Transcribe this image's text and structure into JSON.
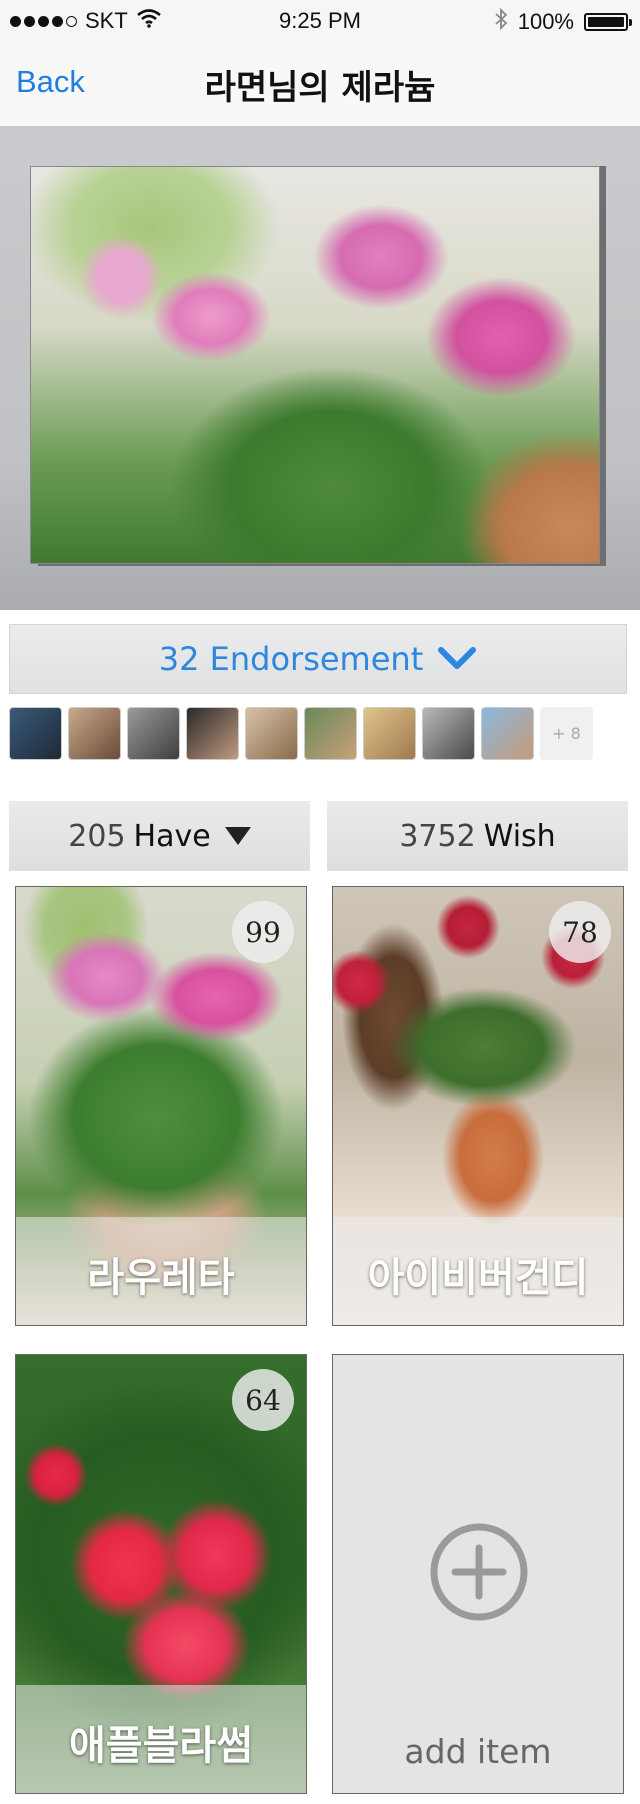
{
  "status_bar": {
    "carrier": "SKT",
    "time": "9:25 PM",
    "battery": "100%",
    "battery_level": 1.0,
    "signal_bars": 4,
    "signal_max": 5
  },
  "nav": {
    "back_label": "Back",
    "title": "라면님의 제라늄"
  },
  "endorsement": {
    "label": "32 Endorsement",
    "avatars": [
      "avatar-1",
      "avatar-2",
      "avatar-3",
      "avatar-4",
      "avatar-5",
      "avatar-6",
      "avatar-7",
      "avatar-8",
      "avatar-9"
    ],
    "more_label": "+ 8"
  },
  "tabs": {
    "have": {
      "count": "205",
      "label": "Have"
    },
    "wish": {
      "count": "3752",
      "label": "Wish"
    }
  },
  "cards": [
    {
      "name": "라우레타",
      "count": "99"
    },
    {
      "name": "아이비버건디",
      "count": "78"
    },
    {
      "name": "애플블라썸",
      "count": "64"
    }
  ],
  "add_item": {
    "label": "add item"
  },
  "colors": {
    "accent": "#1e7fe0",
    "endorse_text": "#2d86e0"
  }
}
